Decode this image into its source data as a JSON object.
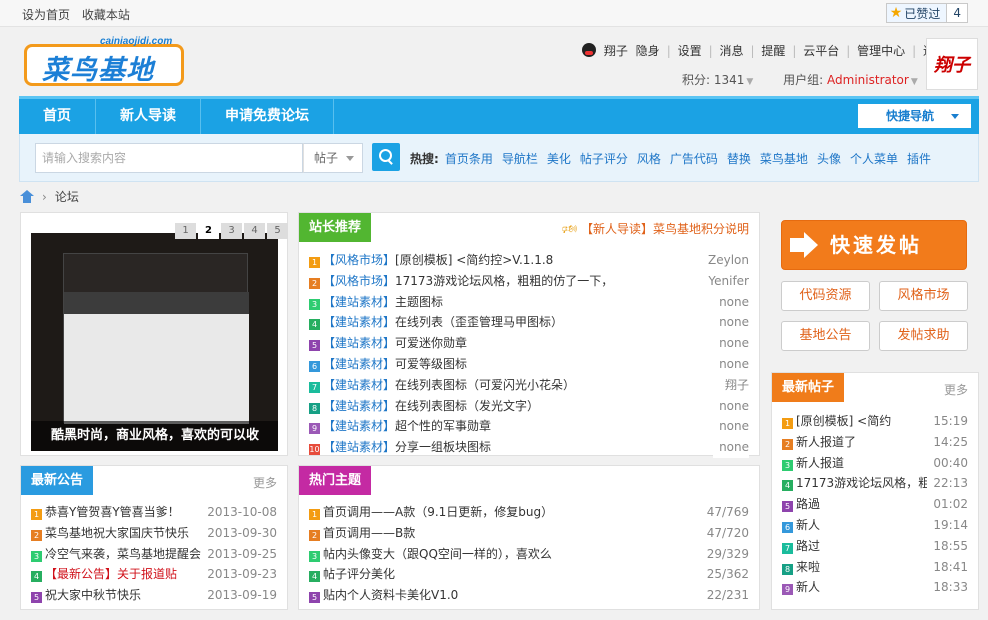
{
  "topbar": {
    "set_home": "设为首页",
    "bookmark": "收藏本站",
    "zan_label": "已赞过",
    "zan_count": "4"
  },
  "logo": {
    "url": "cainiaojidi.com",
    "name": "菜鸟基地"
  },
  "user": {
    "name": "翔子",
    "status": "隐身",
    "links": [
      "设置",
      "消息",
      "提醒",
      "云平台",
      "管理中心",
      "退出"
    ],
    "score_label": "积分: 1341",
    "group_label": "用户组:",
    "group": "Administrator",
    "avatar_text": "翔子"
  },
  "nav": {
    "items": [
      "首页",
      "新人导读",
      "申请免费论坛"
    ],
    "quick": "快捷导航"
  },
  "search": {
    "placeholder": "请输入搜索内容",
    "scope": "帖子",
    "hot_label": "热搜:",
    "hot": [
      "首页条用",
      "导航栏",
      "美化",
      "帖子评分",
      "风格",
      "广告代码",
      "替换",
      "菜鸟基地",
      "头像",
      "个人菜单",
      "插件"
    ]
  },
  "breadcrumb": {
    "current": "论坛"
  },
  "slideshow": {
    "pages": [
      "1",
      "2",
      "3",
      "4",
      "5"
    ],
    "caption": "酷黑时尚，商业风格，喜欢的可以收"
  },
  "recommend": {
    "title": "站长推荐",
    "notice": "【新人导读】菜鸟基地积分说明",
    "items": [
      {
        "n": "1",
        "tag": "【风格市场】",
        "text": "[原创模板] <简约控>V.1.1.8",
        "author": "Zeylon"
      },
      {
        "n": "2",
        "tag": "【风格市场】",
        "text": "17173游戏论坛风格，粗粗的仿了一下，",
        "author": "Yenifer"
      },
      {
        "n": "3",
        "tag": "【建站素材】",
        "text": "主题图标",
        "author": "none"
      },
      {
        "n": "4",
        "tag": "【建站素材】",
        "text": "在线列表（歪歪管理马甲图标）",
        "author": "none"
      },
      {
        "n": "5",
        "tag": "【建站素材】",
        "text": "可爱迷你勋章",
        "author": "none"
      },
      {
        "n": "6",
        "tag": "【建站素材】",
        "text": "可爱等级图标",
        "author": "none"
      },
      {
        "n": "7",
        "tag": "【建站素材】",
        "text": "在线列表图标（可爱闪光小花朵）",
        "author": "翔子"
      },
      {
        "n": "8",
        "tag": "【建站素材】",
        "text": "在线列表图标（发光文字）",
        "author": "none"
      },
      {
        "n": "9",
        "tag": "【建站素材】",
        "text": "超个性的军事勋章",
        "author": "none"
      },
      {
        "n": "10",
        "tag": "【建站素材】",
        "text": "分享一组板块图标",
        "author": "none"
      }
    ]
  },
  "side": {
    "fast_post": "快速发帖",
    "buttons": [
      "代码资源",
      "风格市场",
      "基地公告",
      "发帖求助"
    ]
  },
  "latest_posts": {
    "title": "最新帖子",
    "more": "更多",
    "items": [
      {
        "n": "1",
        "text": "[原创模板] <简约",
        "time": "15:19"
      },
      {
        "n": "2",
        "text": "新人报道了",
        "time": "14:25"
      },
      {
        "n": "3",
        "text": "新人报道",
        "time": "00:40"
      },
      {
        "n": "4",
        "text": "17173游戏论坛风格，粗",
        "time": "22:13"
      },
      {
        "n": "5",
        "text": "路過",
        "time": "01:02"
      },
      {
        "n": "6",
        "text": "新人",
        "time": "19:14"
      },
      {
        "n": "7",
        "text": "路过",
        "time": "18:55"
      },
      {
        "n": "8",
        "text": "来啦",
        "time": "18:41"
      },
      {
        "n": "9",
        "text": "新人",
        "time": "18:33"
      }
    ]
  },
  "announcements": {
    "title": "最新公告",
    "more": "更多",
    "items": [
      {
        "n": "1",
        "text": "恭喜Y管贺喜Y管喜当爹！",
        "date": "2013-10-08",
        "red": false
      },
      {
        "n": "2",
        "text": "菜鸟基地祝大家国庆节快乐",
        "date": "2013-09-30",
        "red": false
      },
      {
        "n": "3",
        "text": "冷空气来袭，菜鸟基地提醒会",
        "date": "2013-09-25",
        "red": false
      },
      {
        "n": "4",
        "text": "【最新公告】关于报道贴",
        "date": "2013-09-23",
        "red": true
      },
      {
        "n": "5",
        "text": "祝大家中秋节快乐",
        "date": "2013-09-19",
        "red": false
      }
    ]
  },
  "hot_topics": {
    "title": "热门主题",
    "items": [
      {
        "n": "1",
        "text": "首页调用——A款（9.1日更新，修复bug）",
        "stat": "47/769"
      },
      {
        "n": "2",
        "text": "首页调用——B款",
        "stat": "47/720"
      },
      {
        "n": "3",
        "text": "帖内头像变大（跟QQ空间一样的），喜欢么",
        "stat": "29/329"
      },
      {
        "n": "4",
        "text": "帖子评分美化",
        "stat": "25/362"
      },
      {
        "n": "5",
        "text": "贴内个人资料卡美化V1.0",
        "stat": "22/231"
      }
    ]
  },
  "colors": {
    "nav": "#1ba2e4",
    "recommend": "#52b631",
    "latest": "#f07c1a",
    "announce": "#2a9be0",
    "hot": "#c42aa3",
    "fast_post": "#f27b1b"
  }
}
